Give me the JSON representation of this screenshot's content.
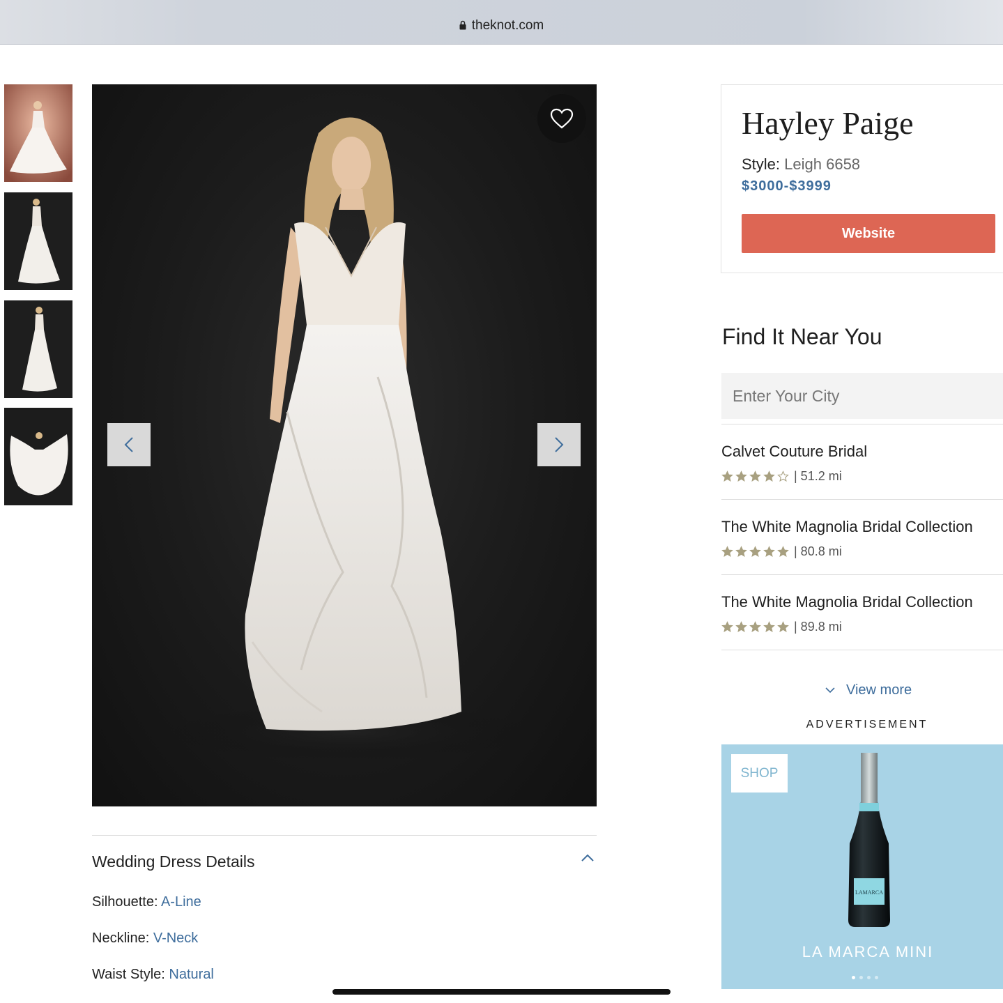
{
  "browser": {
    "url": "theknot.com",
    "lock_icon": "lock-icon"
  },
  "gallery": {
    "thumbnails": [
      {
        "icon": "dress-thumbnail-1"
      },
      {
        "icon": "dress-thumbnail-2"
      },
      {
        "icon": "dress-thumbnail-3"
      },
      {
        "icon": "dress-thumbnail-4"
      }
    ],
    "favorite_icon": "heart-icon",
    "prev_icon": "chevron-left-icon",
    "next_icon": "chevron-right-icon"
  },
  "details": {
    "title": "Wedding Dress Details",
    "rows": [
      {
        "label": "Silhouette:",
        "value": "A-Line"
      },
      {
        "label": "Neckline:",
        "value": "V-Neck"
      },
      {
        "label": "Waist Style:",
        "value": "Natural"
      }
    ]
  },
  "product": {
    "designer": "Hayley Paige",
    "style_label": "Style:",
    "style_value": "Leigh 6658",
    "price": "$3000-$3999",
    "website_label": "Website"
  },
  "near_you": {
    "title": "Find It Near You",
    "city_placeholder": "Enter Your City",
    "stores": [
      {
        "name": "Calvet Couture Bridal",
        "rating": 4,
        "distance": "| 51.2 mi"
      },
      {
        "name": "The White Magnolia Bridal Collection",
        "rating": 5,
        "distance": "| 80.8 mi"
      },
      {
        "name": "The White Magnolia Bridal Collection",
        "rating": 5,
        "distance": "| 89.8 mi"
      }
    ],
    "view_more": "View more"
  },
  "ad": {
    "label": "ADVERTISEMENT",
    "shop": "SHOP",
    "brand": "LA MARCA MINI",
    "bottle_label": "LAMARCA",
    "slides": 4,
    "active_slide": 1
  },
  "colors": {
    "accent_link": "#3e6d9c",
    "website_button": "#dd6654",
    "star": "#a8a080",
    "ad_background": "#a8d3e6"
  }
}
